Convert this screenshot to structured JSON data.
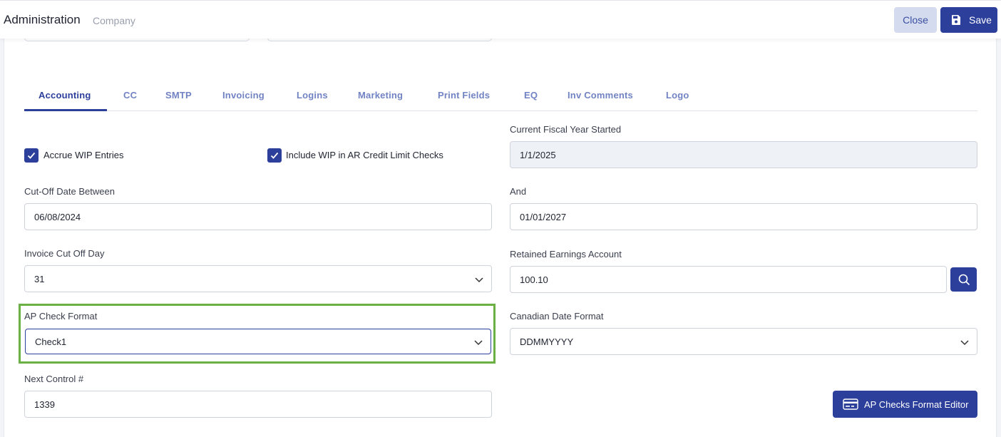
{
  "header": {
    "title": "Administration",
    "subtitle": "Company",
    "close_label": "Close",
    "save_label": "Save"
  },
  "tabs": [
    {
      "label": "Accounting",
      "active": true
    },
    {
      "label": "CC"
    },
    {
      "label": "SMTP"
    },
    {
      "label": "Invoicing"
    },
    {
      "label": "Logins"
    },
    {
      "label": "Marketing"
    },
    {
      "label": "Print Fields"
    },
    {
      "label": "EQ"
    },
    {
      "label": "Inv Comments"
    },
    {
      "label": "Logo"
    }
  ],
  "form": {
    "accrue_wip": {
      "label": "Accrue WIP Entries",
      "checked": true
    },
    "include_wip": {
      "label": "Include WIP in AR Credit Limit Checks",
      "checked": true
    },
    "fiscal_year": {
      "label": "Current Fiscal Year Started",
      "value": "1/1/2025"
    },
    "cutoff_between": {
      "label": "Cut-Off Date Between",
      "value": "06/08/2024"
    },
    "cutoff_and": {
      "label": "And",
      "value": "01/01/2027"
    },
    "invoice_cutoff_day": {
      "label": "Invoice Cut Off Day",
      "value": "31"
    },
    "retained_earnings": {
      "label": "Retained Earnings Account",
      "value": "100.10"
    },
    "ap_check_format": {
      "label": "AP Check Format",
      "value": "Check1"
    },
    "canadian_date_format": {
      "label": "Canadian Date Format",
      "value": "DDMMYYYY"
    },
    "next_control": {
      "label": "Next Control #",
      "value": "1339"
    },
    "ap_checks_editor_label": "AP Checks Format Editor"
  },
  "colors": {
    "primary": "#2b3f9b",
    "tab_inactive": "#7283c4",
    "highlight": "#6bb044",
    "close_bg": "#d5dbef"
  }
}
